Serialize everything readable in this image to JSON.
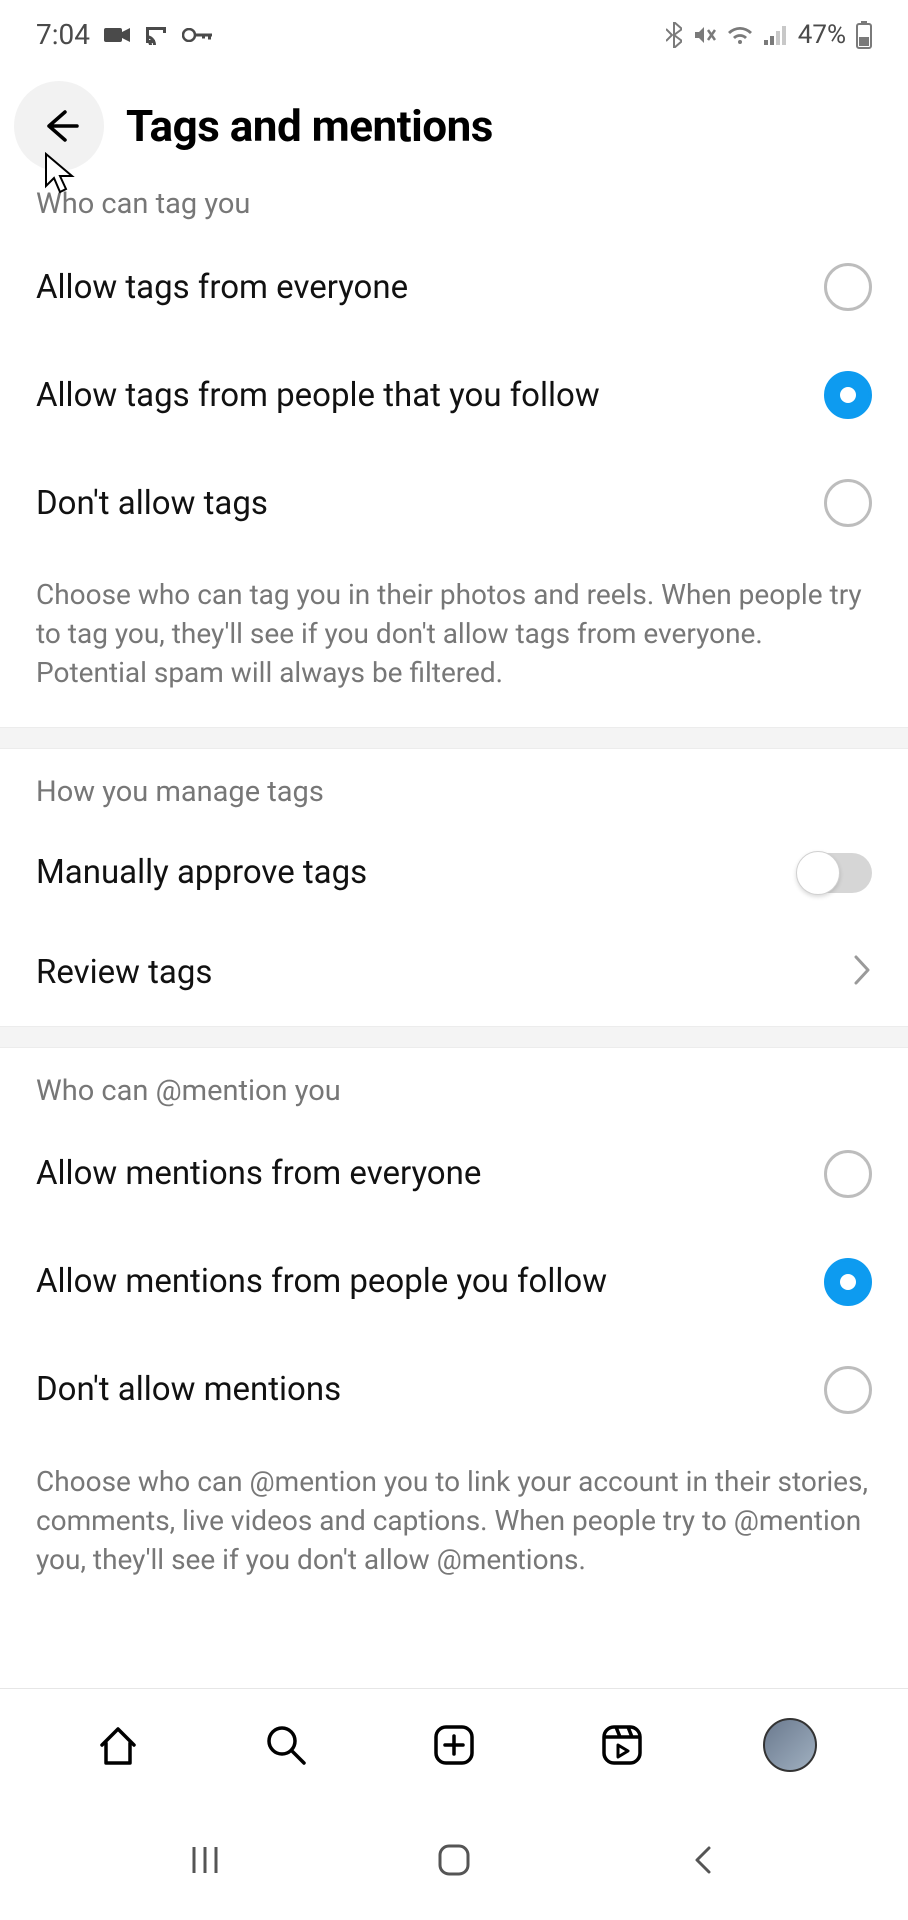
{
  "statusBar": {
    "time": "7:04",
    "battery": "47%"
  },
  "header": {
    "title": "Tags and mentions"
  },
  "sections": {
    "tags": {
      "label": "Who can tag you",
      "options": {
        "everyone": "Allow tags from everyone",
        "following": "Allow tags from people that you follow",
        "none": "Don't allow tags"
      },
      "selected": "following",
      "help": "Choose who can tag you in their photos and reels. When people try to tag you, they'll see if you don't allow tags from everyone. Potential spam will always be filtered."
    },
    "manage": {
      "label": "How you manage tags",
      "manualApprove": "Manually approve tags",
      "manualApproveOn": false,
      "reviewTags": "Review tags"
    },
    "mentions": {
      "label": "Who can @mention you",
      "options": {
        "everyone": "Allow mentions from everyone",
        "following": "Allow mentions from people you follow",
        "none": "Don't allow mentions"
      },
      "selected": "following",
      "help": "Choose who can @mention you to link your account in their stories, comments, live videos and captions. When people try to @mention you, they'll see if you don't allow @mentions."
    }
  }
}
